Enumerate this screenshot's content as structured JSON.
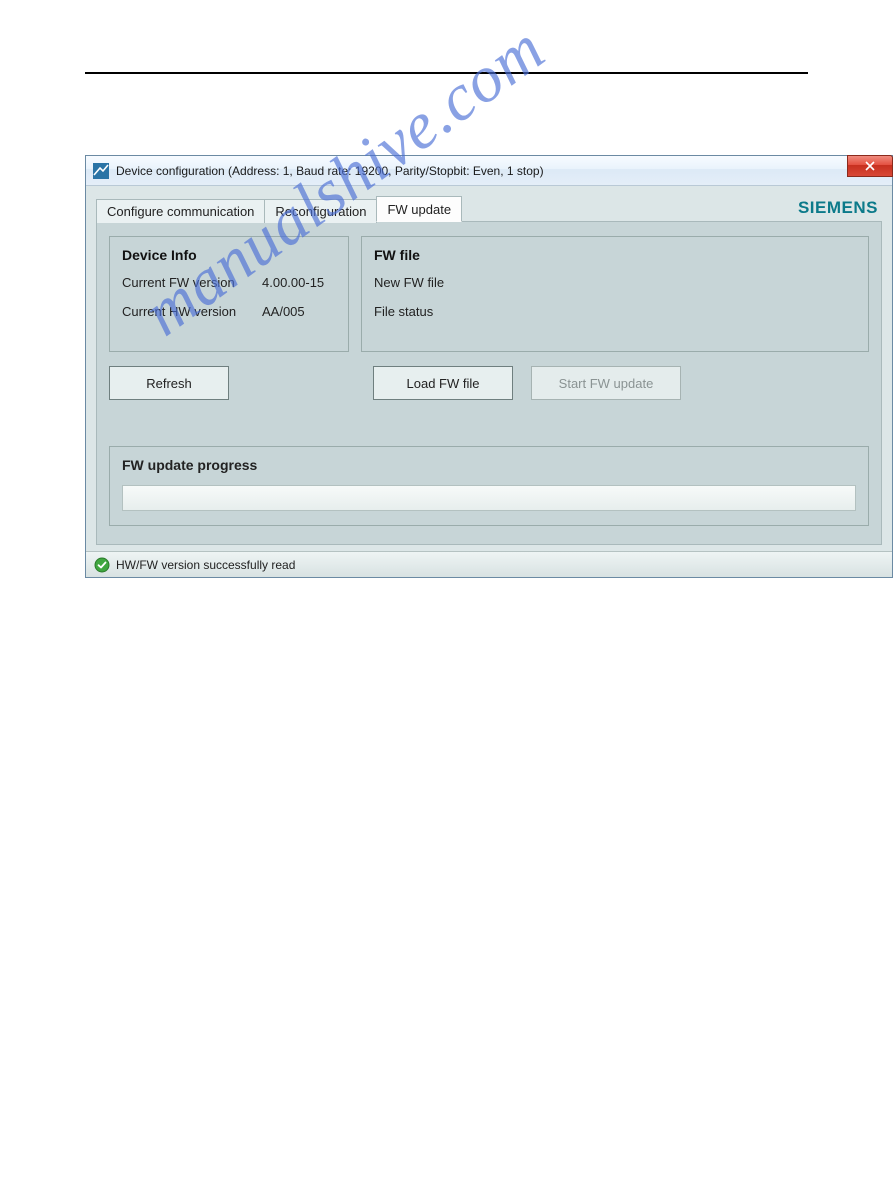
{
  "window": {
    "title": "Device configuration (Address: 1, Baud rate: 19200, Parity/Stopbit: Even, 1 stop)"
  },
  "brand": "SIEMENS",
  "tabs": [
    {
      "label": "Configure communication",
      "active": false
    },
    {
      "label": "Reconfiguration",
      "active": false
    },
    {
      "label": "FW update",
      "active": true
    }
  ],
  "device_info": {
    "title": "Device Info",
    "fw_label": "Current FW version",
    "fw_value": "4.00.00-15",
    "hw_label": "Current HW version",
    "hw_value": "AA/005",
    "refresh_label": "Refresh"
  },
  "fw_file": {
    "title": "FW file",
    "new_file_label": "New FW file",
    "new_file_value": "",
    "status_label": "File status",
    "status_value": "",
    "load_label": "Load FW file",
    "start_label": "Start FW update"
  },
  "progress": {
    "title": "FW update progress"
  },
  "status": {
    "text": "HW/FW version successfully read"
  },
  "watermark": "manualshive.com"
}
